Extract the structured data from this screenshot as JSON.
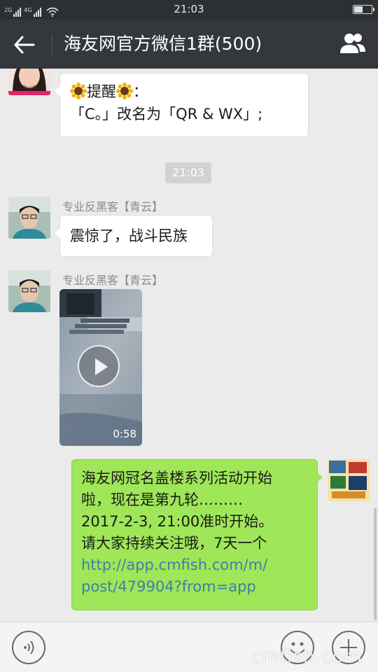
{
  "status_bar": {
    "sim1_label": "2G",
    "sim2_label": "4G",
    "time": "21:03",
    "battery_level": 0.45
  },
  "header": {
    "title": "海友网官方微信1群(500)",
    "back_icon": "arrow-left-icon",
    "group_icon": "group-members-icon"
  },
  "messages": [
    {
      "type": "text",
      "side": "left",
      "prefix": "提醒",
      "line1_suffix": "：",
      "line2": "「C。」改名为「QR & WX」;"
    },
    {
      "type": "time",
      "text": "21:03"
    },
    {
      "type": "text",
      "side": "left",
      "sender": "专业反黑客【青云】",
      "text": "震惊了，战斗民族"
    },
    {
      "type": "video",
      "side": "left",
      "sender": "专业反黑客【青云】",
      "duration": "0:58"
    },
    {
      "type": "text",
      "side": "right",
      "lines": [
        "海友网冠名盖楼系列活动开始",
        "啦，现在是第九轮………",
        "2017-2-3, 21:00准时开始。",
        "请大家持续关注哦，7天一个"
      ],
      "link_lines": [
        "http://app.cmfish.com/m/",
        "post/479904?from=app"
      ]
    }
  ],
  "input_bar": {
    "voice_icon": "voice-icon",
    "emoji_icon": "emoji-icon",
    "plus_icon": "plus-icon",
    "watermark": "cmfish.com"
  },
  "colors": {
    "header_bg": "#34373b",
    "status_bg": "#2d3033",
    "chat_bg": "#ebebeb",
    "green_bubble": "#9fe658",
    "link": "#3f7fa6"
  }
}
